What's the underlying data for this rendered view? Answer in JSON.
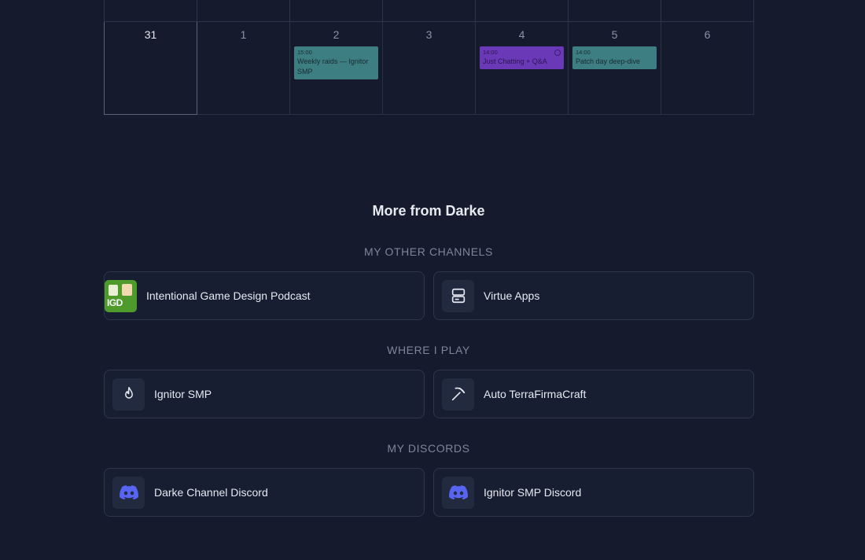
{
  "calendar": {
    "days": [
      {
        "num": "31",
        "current": true
      },
      {
        "num": "1"
      },
      {
        "num": "2",
        "event": {
          "time": "15:00",
          "title": "Weekly raids — Ignitor SMP",
          "color": "#3c7e82"
        }
      },
      {
        "num": "3"
      },
      {
        "num": "4",
        "event": {
          "time": "14:00",
          "title": "Just Chatting + Q&A",
          "color": "#6a39b8"
        }
      },
      {
        "num": "5",
        "event": {
          "time": "14:00",
          "title": "Patch day deep-dive",
          "color": "#3c7e82"
        }
      },
      {
        "num": "6"
      }
    ]
  },
  "more": {
    "title": "More from Darke",
    "groups": {
      "channels": {
        "label": "MY OTHER CHANNELS",
        "items": [
          {
            "label": "Intentional Game Design Podcast",
            "icon": "igd-podcast-logo",
            "logo_text": "IGD"
          },
          {
            "label": "Virtue Apps",
            "icon": "server-icon"
          }
        ]
      },
      "play": {
        "label": "WHERE I PLAY",
        "items": [
          {
            "label": "Ignitor SMP",
            "icon": "flame-icon"
          },
          {
            "label": "Auto TerraFirmaCraft",
            "icon": "pickaxe-icon"
          }
        ]
      },
      "discords": {
        "label": "MY DISCORDS",
        "items": [
          {
            "label": "Darke Channel Discord",
            "icon": "discord-icon"
          },
          {
            "label": "Ignitor SMP Discord",
            "icon": "discord-icon"
          }
        ]
      }
    }
  },
  "colors": {
    "background": "#151b2d",
    "card_border": "#2e3649",
    "discord": "#5865f2",
    "event_teal": "#3c7e82",
    "event_purple": "#6a39b8"
  }
}
